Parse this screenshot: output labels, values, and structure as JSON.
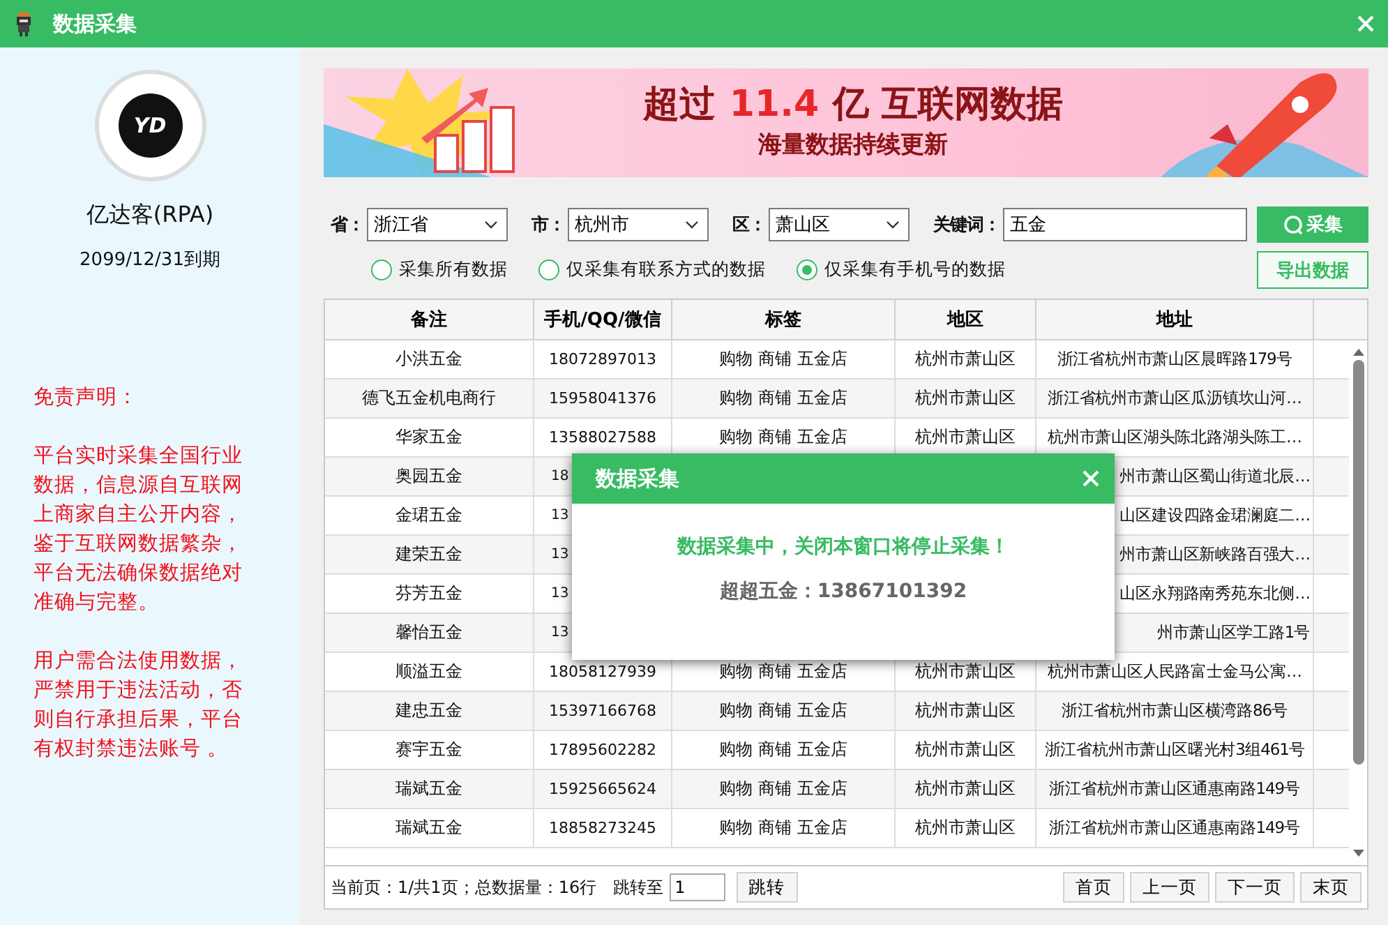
{
  "window": {
    "title": "数据采集"
  },
  "profile": {
    "logo_text": "YD",
    "name": "亿达客(RPA)",
    "expiry": "2099/12/31到期"
  },
  "disclaimer": {
    "title": "免责声明：",
    "paragraphs": [
      "平台实时采集全国行业数据，信息源自互联网上商家自主公开内容，鉴于互联网数据繁杂，平台无法确保数据绝对准确与完整。",
      "用户需合法使用数据，严禁用于违法活动，否则自行承担后果，平台有权封禁违法账号 。"
    ]
  },
  "banner": {
    "headline": [
      {
        "text": "超过",
        "emphasis": false
      },
      {
        "text": "11.4",
        "emphasis": true
      },
      {
        "text": "亿 互联网数据",
        "emphasis": false
      }
    ],
    "subtitle": "海量数据持续更新"
  },
  "filters": [
    {
      "label": "省：",
      "value": "浙江省",
      "kind": "select"
    },
    {
      "label": "市：",
      "value": "杭州市",
      "kind": "select"
    },
    {
      "label": "区：",
      "value": "萧山区",
      "kind": "select"
    },
    {
      "label": "关键词：",
      "value": "五金",
      "kind": "input"
    }
  ],
  "collect_button": "采集",
  "export_button": "导出数据",
  "scope_options": [
    {
      "label": "采集所有数据",
      "selected": false
    },
    {
      "label": "仅采集有联系方式的数据",
      "selected": false
    },
    {
      "label": "仅采集有手机号的数据",
      "selected": true
    }
  ],
  "table": {
    "columns": [
      "备注",
      "手机/QQ/微信",
      "标签",
      "地区",
      "地址"
    ],
    "rows": [
      {
        "note": "小洪五金",
        "phone": "18072897013",
        "tags": "购物 商铺 五金店",
        "region": "杭州市萧山区",
        "address": "浙江省杭州市萧山区晨晖路179号",
        "covered": false
      },
      {
        "note": "德飞五金机电商行",
        "phone": "15958041376",
        "tags": "购物 商铺 五金店",
        "region": "杭州市萧山区",
        "address": "浙江省杭州市萧山区瓜沥镇坎山河…",
        "covered": false
      },
      {
        "note": "华家五金",
        "phone": "13588027588",
        "tags": "购物 商铺 五金店",
        "region": "杭州市萧山区",
        "address": "杭州市萧山区湖头陈北路湖头陈工…",
        "covered": false
      },
      {
        "note": "奥园五金",
        "phone": "18",
        "address": "州市萧山区蜀山街道北辰…",
        "covered": true
      },
      {
        "note": "金珺五金",
        "phone": "13",
        "address": "山区建设四路金珺澜庭二…",
        "covered": true
      },
      {
        "note": "建荣五金",
        "phone": "13",
        "address": "州市萧山区新峡路百强大…",
        "covered": true
      },
      {
        "note": "芬芳五金",
        "phone": "13",
        "address": "山区永翔路南秀苑东北侧…",
        "covered": true
      },
      {
        "note": "馨怡五金",
        "phone": "13",
        "address": "州市萧山区学工路1号",
        "covered": true
      },
      {
        "note": "顺溢五金",
        "phone": "18058127939",
        "tags": "购物 商铺 五金店",
        "region": "杭州市萧山区",
        "address": "杭州市萧山区人民路富士金马公寓…",
        "covered": false
      },
      {
        "note": "建忠五金",
        "phone": "15397166768",
        "tags": "购物 商铺 五金店",
        "region": "杭州市萧山区",
        "address": "浙江省杭州市萧山区横湾路86号",
        "covered": false
      },
      {
        "note": "赛宇五金",
        "phone": "17895602282",
        "tags": "购物 商铺 五金店",
        "region": "杭州市萧山区",
        "address": "浙江省杭州市萧山区曙光村3组461号",
        "covered": false
      },
      {
        "note": "瑞斌五金",
        "phone": "15925665624",
        "tags": "购物 商铺 五金店",
        "region": "杭州市萧山区",
        "address": "浙江省杭州市萧山区通惠南路149号",
        "covered": false
      },
      {
        "note": "瑞斌五金",
        "phone": "18858273245",
        "tags": "购物 商铺 五金店",
        "region": "杭州市萧山区",
        "address": "浙江省杭州市萧山区通惠南路149号",
        "covered": false
      }
    ]
  },
  "pagination": {
    "summary": "当前页：1/共1页；总数据量：16行",
    "jump_label": "跳转至",
    "jump_value": "1",
    "jump_button": "跳转",
    "buttons": [
      "首页",
      "上一页",
      "下一页",
      "末页"
    ]
  },
  "dialog": {
    "title": "数据采集",
    "message": "数据采集中，关闭本窗口将停止采集！",
    "detail": "超超五金：13867101392"
  }
}
